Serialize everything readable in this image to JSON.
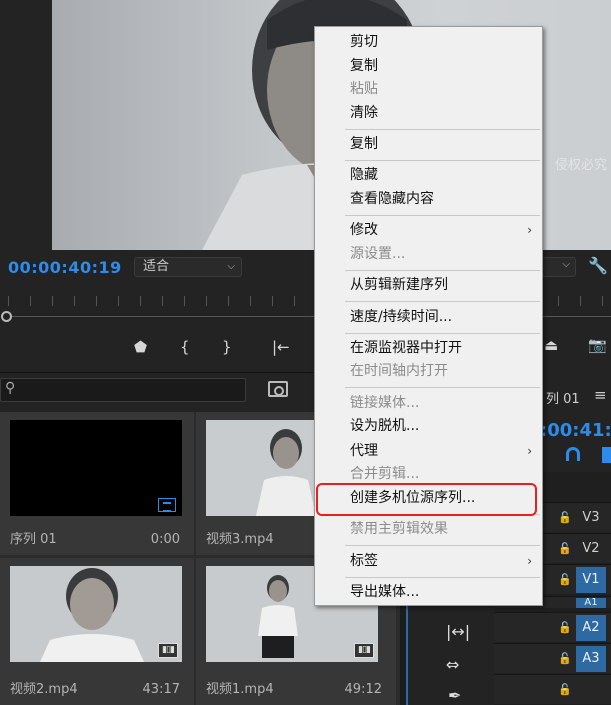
{
  "program_monitor": {
    "watermark": "侵权必究",
    "timecode": "00:00:40:19",
    "fit_option": "适合"
  },
  "project_panel": {
    "clips": [
      {
        "name": "序列 01",
        "duration": "0:00"
      },
      {
        "name": "视频3.mp4",
        "duration": ""
      },
      {
        "name": "视频2.mp4",
        "duration": "43:17"
      },
      {
        "name": "视频1.mp4",
        "duration": "49:12"
      }
    ]
  },
  "timeline": {
    "title": "列 01",
    "menu_glyph": "≡",
    "timecode": ":00:41:",
    "tracks": [
      "V3",
      "V2",
      "V1",
      "A1",
      "A2",
      "A3"
    ]
  },
  "context_menu": {
    "items": [
      {
        "label": "剪切",
        "enabled": true
      },
      {
        "label": "复制",
        "enabled": true
      },
      {
        "label": "粘贴",
        "enabled": false
      },
      {
        "label": "清除",
        "enabled": true
      },
      {
        "label": "复制",
        "enabled": true
      },
      {
        "label": "隐藏",
        "enabled": true
      },
      {
        "label": "查看隐藏内容",
        "enabled": true
      },
      {
        "label": "修改",
        "enabled": true,
        "submenu": true
      },
      {
        "label": "源设置...",
        "enabled": false
      },
      {
        "label": "从剪辑新建序列",
        "enabled": true
      },
      {
        "label": "速度/持续时间...",
        "enabled": true
      },
      {
        "label": "在源监视器中打开",
        "enabled": true
      },
      {
        "label": "在时间轴内打开",
        "enabled": false
      },
      {
        "label": "链接媒体...",
        "enabled": false
      },
      {
        "label": "设为脱机...",
        "enabled": true
      },
      {
        "label": "代理",
        "enabled": true,
        "submenu": true
      },
      {
        "label": "合并剪辑...",
        "enabled": false
      },
      {
        "label": "创建多机位源序列...",
        "enabled": true,
        "highlighted": true
      },
      {
        "label": "禁用主剪辑效果",
        "enabled": false
      },
      {
        "label": "标签",
        "enabled": true,
        "submenu": true
      },
      {
        "label": "导出媒体...",
        "enabled": true
      }
    ],
    "submenu_arrow": "›"
  },
  "colors": {
    "accent_blue": "#2d8ceb",
    "highlight_red": "#e82020",
    "menu_bg": "#f0f0f0",
    "panel_bg": "#232323"
  }
}
